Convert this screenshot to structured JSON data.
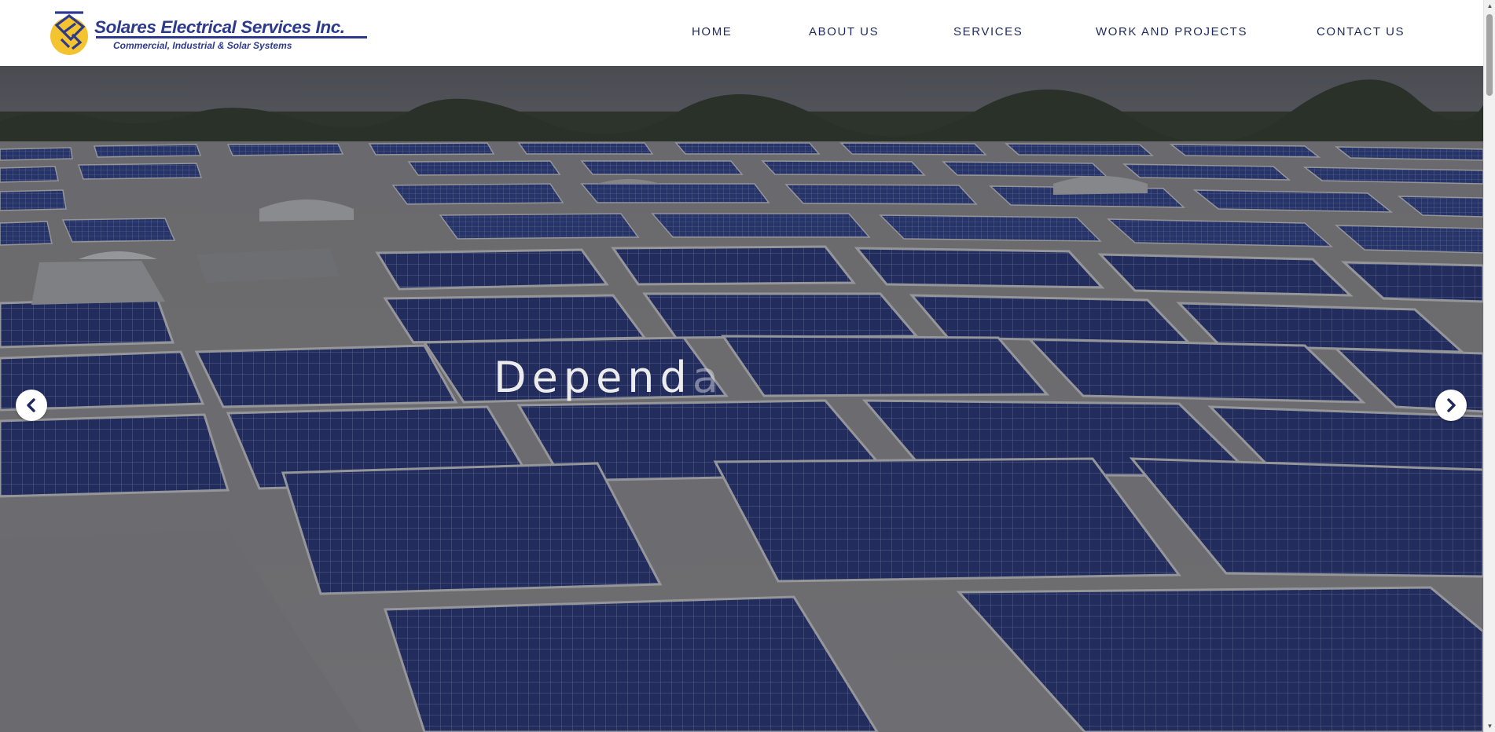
{
  "brand": {
    "name": "Solares Electrical Services Inc.",
    "tagline": "Commercial, Industrial & Solar Systems",
    "logo_icon": "sun-grid-logo",
    "primary_color": "#2d3a8c",
    "accent_color": "#f4c430"
  },
  "nav": {
    "items": [
      {
        "label": "HOME"
      },
      {
        "label": "ABOUT US"
      },
      {
        "label": "SERVICES"
      },
      {
        "label": "WORK AND PROJECTS"
      },
      {
        "label": "CONTACT US"
      }
    ]
  },
  "hero": {
    "heading_visible": "Depend",
    "heading_fading": "a",
    "heading_faint": "",
    "prev_icon": "chevron-left-icon",
    "next_icon": "chevron-right-icon",
    "image_subject": "rooftop-solar-panels"
  }
}
